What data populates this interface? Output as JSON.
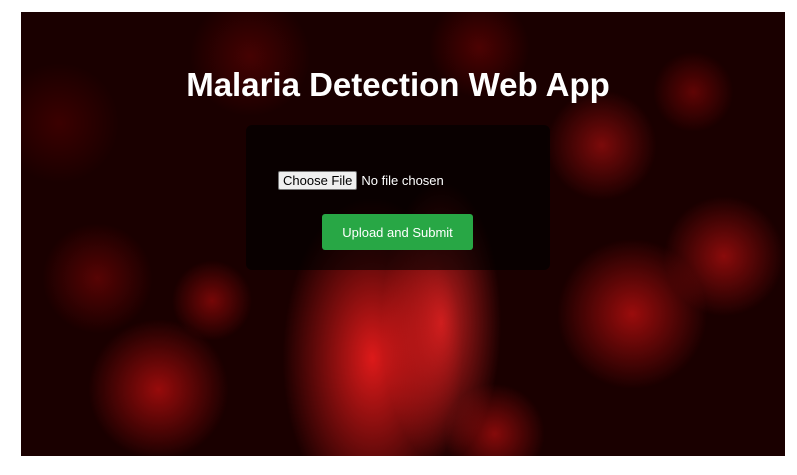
{
  "page": {
    "title": "Malaria Detection Web App"
  },
  "upload_form": {
    "file_button_label": "Choose File",
    "file_status": "No file chosen",
    "submit_label": "Upload and Submit"
  },
  "colors": {
    "submit_button": "#28a745",
    "background_tint": "#1a0000",
    "panel_background": "rgba(0,0,0,0.62)"
  }
}
